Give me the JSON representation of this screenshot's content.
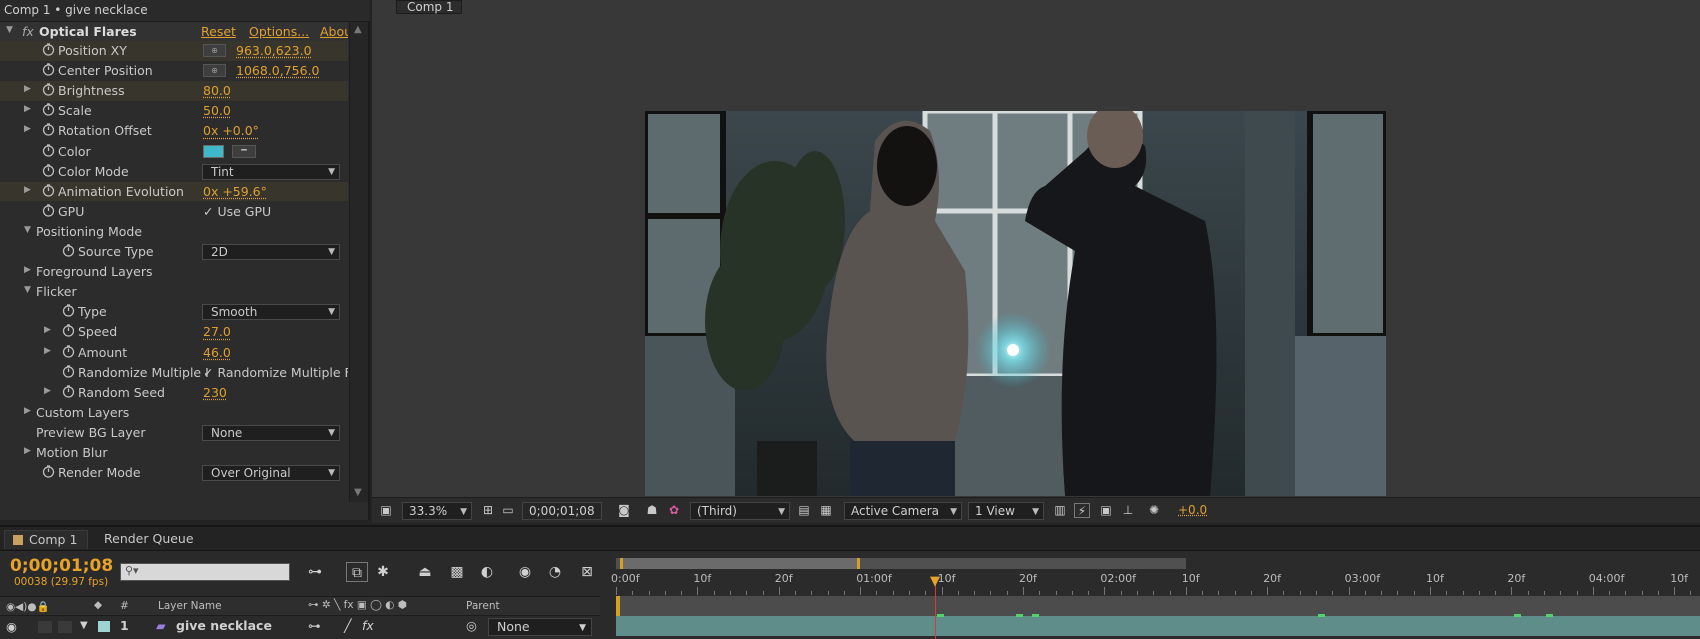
{
  "effects_panel": {
    "title": "Comp 1 • give necklace",
    "effect_name": "Optical Flares",
    "fx_label": "fx",
    "reset": "Reset",
    "options": "Options...",
    "about": "Abou",
    "properties": [
      {
        "name": "Position XY",
        "value": "963.0,623.0",
        "kind": "point"
      },
      {
        "name": "Center Position",
        "value": "1068.0,756.0",
        "kind": "point"
      },
      {
        "name": "Brightness",
        "value": "80.0",
        "kind": "num"
      },
      {
        "name": "Scale",
        "value": "50.0",
        "kind": "num"
      },
      {
        "name": "Rotation Offset",
        "value": "0x +0.0°",
        "kind": "num"
      },
      {
        "name": "Color",
        "value": "",
        "kind": "color",
        "color": "#3fb8c9"
      },
      {
        "name": "Color Mode",
        "value": "Tint",
        "kind": "dropdown"
      },
      {
        "name": "Animation Evolution",
        "value": "0x +59.6°",
        "kind": "num"
      },
      {
        "name": "GPU",
        "value": "Use GPU",
        "kind": "check"
      },
      {
        "name": "Positioning Mode",
        "value": "",
        "kind": "group"
      },
      {
        "name": "Source Type",
        "value": "2D",
        "kind": "dropdown"
      },
      {
        "name": "Foreground Layers",
        "value": "",
        "kind": "group"
      },
      {
        "name": "Flicker",
        "value": "",
        "kind": "group"
      },
      {
        "name": "Type",
        "value": "Smooth",
        "kind": "dropdown"
      },
      {
        "name": "Speed",
        "value": "27.0",
        "kind": "num"
      },
      {
        "name": "Amount",
        "value": "46.0",
        "kind": "num"
      },
      {
        "name": "Randomize Multiple I",
        "value": "Randomize Multiple F",
        "kind": "check"
      },
      {
        "name": "Random Seed",
        "value": "230",
        "kind": "num"
      },
      {
        "name": "Custom Layers",
        "value": "",
        "kind": "group"
      },
      {
        "name": "Preview BG Layer",
        "value": "None",
        "kind": "dropdown"
      },
      {
        "name": "Motion Blur",
        "value": "",
        "kind": "group"
      },
      {
        "name": "Render Mode",
        "value": "Over Original",
        "kind": "dropdown"
      }
    ]
  },
  "viewer": {
    "comp_tab": "Comp 1",
    "zoom": "33.3%",
    "timecode": "0;00;01;08",
    "resolution": "(Third)",
    "camera": "Active Camera",
    "views": "1 View",
    "exposure": "+0.0"
  },
  "timeline": {
    "tabs": [
      "Comp 1",
      "Render Queue"
    ],
    "timecode": "0;00;01;08",
    "fps": "00038 (29.97 fps)",
    "search_placeholder": "",
    "columns": {
      "num": "#",
      "layer_name": "Layer Name",
      "parent": "Parent"
    },
    "layer": {
      "index": "1",
      "name": "give necklace",
      "parent": "None"
    },
    "ruler_labels": [
      "0:00f",
      "10f",
      "20f",
      "01:00f",
      "10f",
      "20f",
      "02:00f",
      "10f",
      "20f",
      "03:00f",
      "10f",
      "20f",
      "04:00f",
      "10f"
    ],
    "accent_color": "#e6a229"
  }
}
